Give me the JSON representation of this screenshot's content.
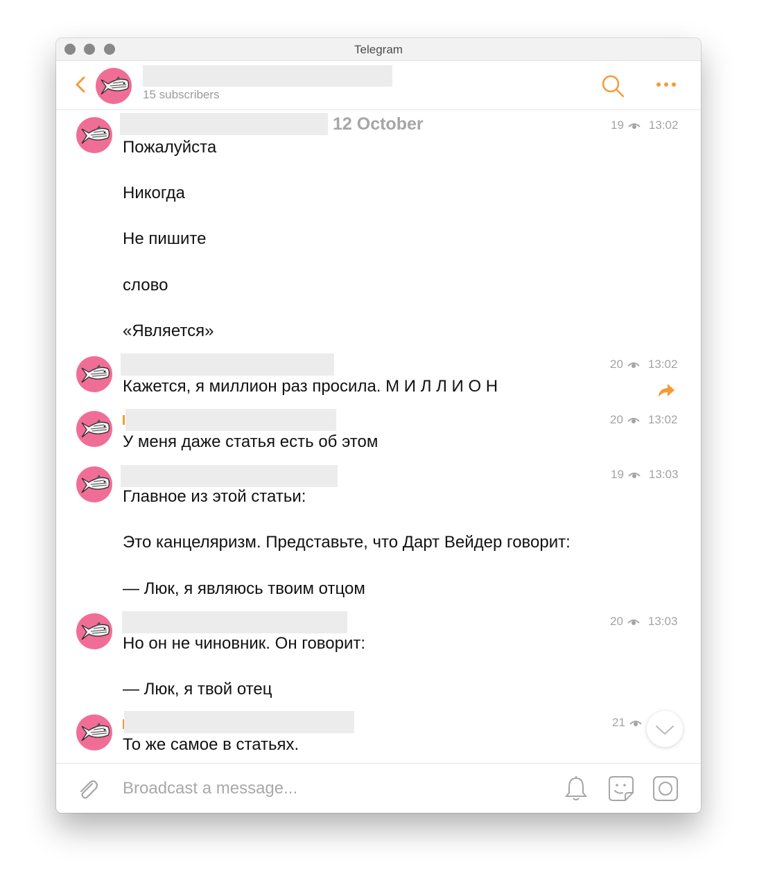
{
  "window": {
    "title": "Telegram"
  },
  "header": {
    "subscribers": "15 subscribers",
    "icons": {
      "back": "chevron-left-icon",
      "search": "search-icon",
      "more": "more-icon"
    },
    "accent_color": "#f39c36"
  },
  "chat": {
    "date_label": "12 October",
    "messages": [
      {
        "views": "19",
        "time": "13:02",
        "lines": [
          "Пожалуйста",
          "Никогда",
          "Не пишите",
          "слово",
          "«Является»"
        ]
      },
      {
        "views": "20",
        "time": "13:02",
        "lines": [
          "Кажется, я миллион раз просила. М И Л Л И О Н"
        ]
      },
      {
        "views": "20",
        "time": "13:02",
        "lines": [
          "У меня даже статья есть об этом"
        ]
      },
      {
        "views": "19",
        "time": "13:03",
        "lines": [
          "Главное из этой статьи:",
          "Это канцеляризм. Представьте, что Дарт Вейдер говорит:",
          "— Люк, я являюсь твоим отцом"
        ]
      },
      {
        "views": "20",
        "time": "13:03",
        "lines": [
          "Но он не чиновник. Он говорит:",
          "— Люк, я твой отец"
        ]
      },
      {
        "views": "21",
        "time": "",
        "lines": [
          "То же самое в статьях."
        ]
      }
    ]
  },
  "composer": {
    "placeholder": "Broadcast a message...",
    "icons": {
      "attach": "paperclip-icon",
      "bell": "bell-icon",
      "sticker": "sticker-icon",
      "camera": "camera-icon"
    }
  },
  "colors": {
    "avatar_pink": "#f06e96",
    "accent": "#f39c36"
  }
}
